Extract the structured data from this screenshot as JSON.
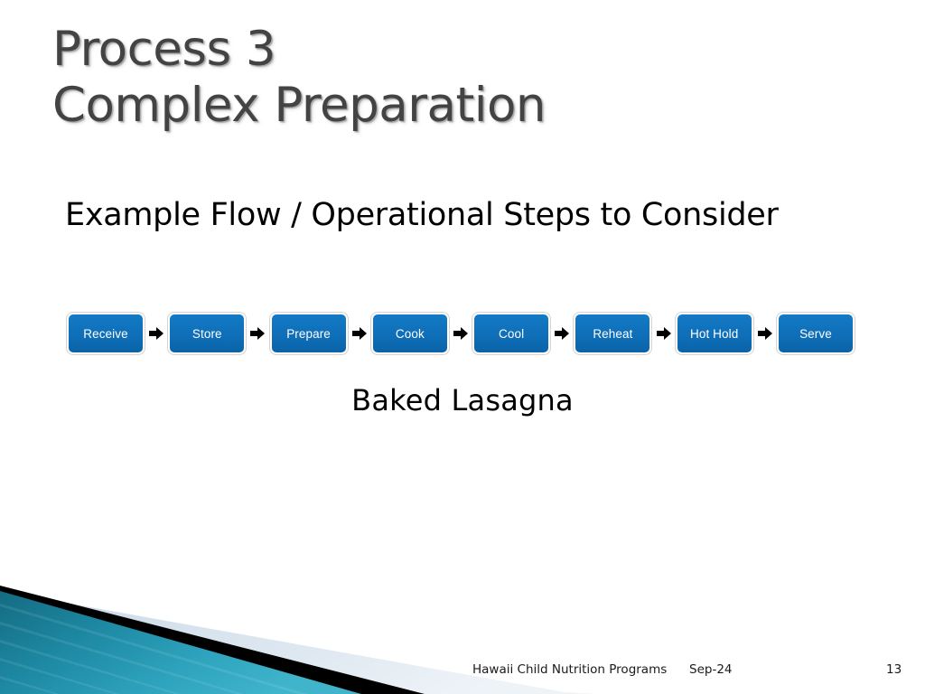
{
  "slide": {
    "title_lines": [
      "Process 3",
      "Complex Preparation"
    ],
    "subtitle": "Example Flow / Operational Steps to Consider",
    "caption": "Baked Lasagna"
  },
  "flow": {
    "arrow_icon": "right-block-arrow-icon",
    "steps": [
      {
        "label": "Receive"
      },
      {
        "label": "Store"
      },
      {
        "label": "Prepare"
      },
      {
        "label": "Cook"
      },
      {
        "label": "Cool"
      },
      {
        "label": "Reheat"
      },
      {
        "label": "Hot Hold"
      },
      {
        "label": "Serve"
      }
    ]
  },
  "footer": {
    "organization": "Hawaii Child Nutrition Programs",
    "date": "Sep-24",
    "page_number": "13"
  },
  "colors": {
    "title_text": "#434343",
    "body_text": "#000000",
    "step_fill": "#0f6fb8",
    "step_text": "#ffffff",
    "arrow": "#000000",
    "deco_teal_dark": "#17798f",
    "deco_teal_light": "#35a6c0",
    "deco_black": "#000000",
    "deco_pale_blue": "#dbe6ef"
  }
}
